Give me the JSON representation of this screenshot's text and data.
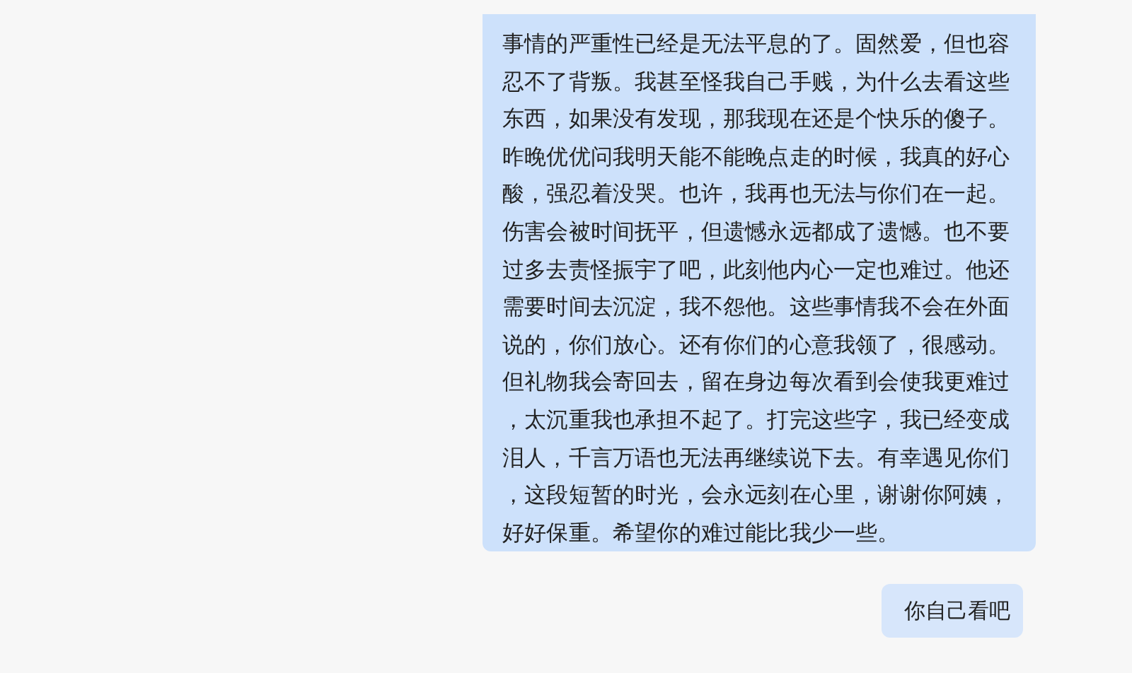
{
  "messages": [
    {
      "kind": "long",
      "lines": [
        "事情的严重性已经是无法平息的了。固然爱，但也容",
        "忍不了背叛。我甚至怪我自己手贱，为什么去看这些",
        "东西，如果没有发现，那我现在还是个快乐的傻子。",
        "昨晚优优问我明天能不能晚点走的时候，我真的好心",
        "酸，强忍着没哭。也许，我再也无法与你们在一起。",
        "伤害会被时间抚平，但遗憾永远都成了遗憾。也不要",
        "过多去责怪振宇了吧，此刻他内心一定也难过。他还",
        "需要时间去沉淀，我不怨他。这些事情我不会在外面",
        "说的，你们放心。还有你们的心意我领了，很感动。",
        "但礼物我会寄回去，留在身边每次看到会使我更难过",
        "，太沉重我也承担不起了。打完这些字，我已经变成",
        "泪人，千言万语也无法再继续说下去。有幸遇见你们",
        "，这段短暂的时光，会永远刻在心里，谢谢你阿姨，",
        "好好保重。希望你的难过能比我少一些。"
      ]
    },
    {
      "kind": "short",
      "lines": [
        "你自己看吧"
      ]
    }
  ]
}
